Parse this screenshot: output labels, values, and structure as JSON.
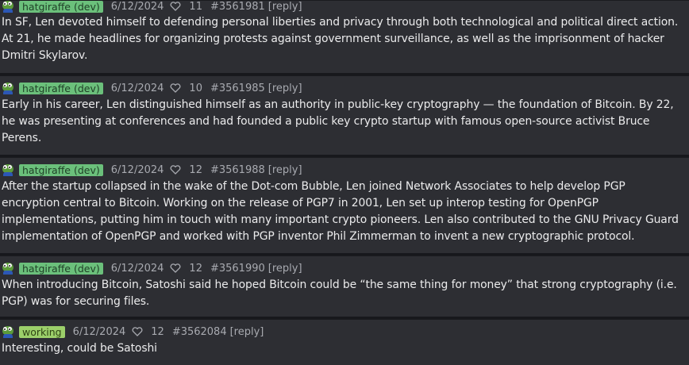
{
  "posts": [
    {
      "author_badge": "hatgiraffe (dev)",
      "date": "6/12/2024",
      "likes": "11",
      "post_id": "#3561981",
      "reply_label": "[reply]",
      "text": "In SF, Len devoted himself to defending personal liberties and privacy through both technological and political direct action. At 21, he made headlines for organizing protests against government surveillance, as well as the imprisonment of hacker Dmitri Skylarov."
    },
    {
      "author_badge": "hatgiraffe (dev)",
      "date": "6/12/2024",
      "likes": "10",
      "post_id": "#3561985",
      "reply_label": "[reply]",
      "text": "Early in his career, Len distinguished himself as an authority in public-key cryptography — the foundation of Bitcoin. By 22, he was presenting at conferences and had founded a public key crypto startup with famous open-source activist Bruce Perens."
    },
    {
      "author_badge": "hatgiraffe (dev)",
      "date": "6/12/2024",
      "likes": "12",
      "post_id": "#3561988",
      "reply_label": "[reply]",
      "text": "After the startup collapsed in the wake of the Dot-com Bubble, Len joined Network Associates to help develop PGP encryption central to Bitcoin. Working on the release of PGP7 in 2001, Len set up interop testing for OpenPGP implementations, putting him in touch with many important crypto pioneers. Len also contributed to the GNU Privacy Guard implementation of OpenPGP and worked with PGP inventor Phil Zimmerman to invent a new cryptographic protocol."
    },
    {
      "author_badge": "hatgiraffe (dev)",
      "date": "6/12/2024",
      "likes": "12",
      "post_id": "#3561990",
      "reply_label": "[reply]",
      "text": "When introducing Bitcoin, Satoshi said he hoped Bitcoin could be “the same thing for money” that strong cryptography (i.e. PGP) was for securing files."
    },
    {
      "author_badge": "working",
      "date": "6/12/2024",
      "likes": "12",
      "post_id": "#3562084",
      "reply_label": "[reply]",
      "text": "Interesting, could be Satoshi"
    }
  ],
  "colors": {
    "dev_badge": "#6bc07b",
    "working_badge": "#9ccf6a",
    "post_bg": "#2d2e33"
  },
  "icons": {
    "avatar": "pepe-avatar-icon",
    "like": "heart-outline-icon"
  }
}
